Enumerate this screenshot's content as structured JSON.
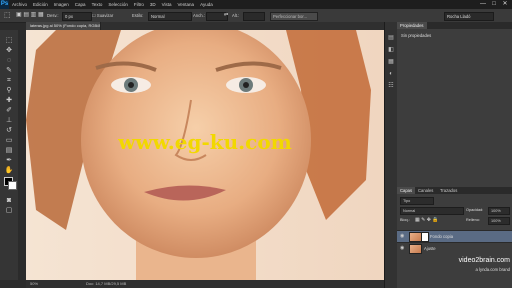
{
  "app": {
    "logo": "Ps"
  },
  "menu": [
    "Archivo",
    "Edición",
    "Imagen",
    "Capa",
    "Texto",
    "Selección",
    "Filtro",
    "3D",
    "Vista",
    "Ventana",
    "Ayuda"
  ],
  "window_controls": [
    "—",
    "□",
    "✕"
  ],
  "options": {
    "feather_label": "Desv.:",
    "feather_value": "0 px",
    "smooth": "Suavizar",
    "style_label": "Estilo:",
    "style_value": "Normal",
    "width": "Anch.:",
    "height": "Alt.:",
    "refine": "Perfeccionar bor...",
    "workspace": "Rocha Lladó"
  },
  "document_tab": "lateras.jpg al 50% (Fondo copia, RGB/8) *",
  "status_bar": {
    "zoom": "50%",
    "doc": "Doc: 14,7 MB/29,5 MB"
  },
  "center_watermark": "www.eg-ku.com",
  "props_panel": {
    "tab": "Propiedades",
    "title": "Sin propiedades"
  },
  "layers_panel": {
    "tabs": [
      "Capas",
      "Canales",
      "Trazados"
    ],
    "filter": "Tipo",
    "blend": "Normal",
    "opacity_label": "Opacidad:",
    "opacity_value": "100%",
    "lock_label": "Bloq.:",
    "fill_label": "Relleno:",
    "fill_value": "100%",
    "layers": [
      {
        "name": "Fondo copia",
        "selected": true
      },
      {
        "name": "Ajuste",
        "selected": false
      }
    ]
  },
  "brand": {
    "name": "video2brain.com",
    "sub": "a lynda.com brand"
  }
}
